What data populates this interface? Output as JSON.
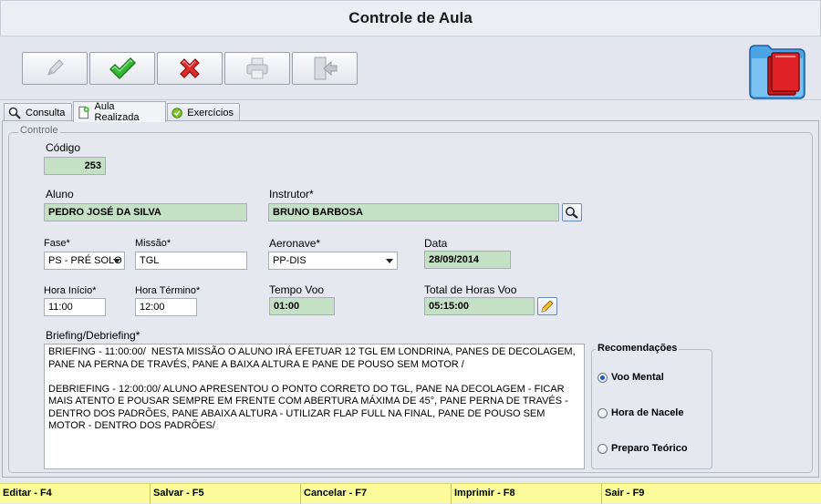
{
  "window": {
    "title": "Controle de Aula"
  },
  "tabs": [
    {
      "label": "Consulta"
    },
    {
      "label": "Aula Realizada"
    },
    {
      "label": "Exercícios"
    }
  ],
  "group": {
    "title": "Controle"
  },
  "form": {
    "codigo": {
      "label": "Código",
      "value": "253"
    },
    "aluno": {
      "label": "Aluno",
      "value": "PEDRO JOSÉ DA SILVA"
    },
    "instrutor": {
      "label": "Instrutor*",
      "value": "BRUNO BARBOSA"
    },
    "fase": {
      "label": "Fase*",
      "value": "PS - PRÉ SOLO"
    },
    "missao": {
      "label": "Missão*",
      "value": "TGL"
    },
    "aeronave": {
      "label": "Aeronave*",
      "value": "PP-DIS"
    },
    "data": {
      "label": "Data",
      "value": "28/09/2014"
    },
    "hora_inicio": {
      "label": "Hora Início*",
      "value": "11:00"
    },
    "hora_termino": {
      "label": "Hora Término*",
      "value": "12:00"
    },
    "tempo_voo": {
      "label": "Tempo Voo",
      "value": "01:00"
    },
    "total_horas": {
      "label": "Total de Horas Voo",
      "value": "05:15:00"
    },
    "briefing": {
      "label": "Briefing/Debriefing*",
      "value": "BRIEFING - 11:00:00/  NESTA MISSÃO O ALUNO IRÁ EFETUAR 12 TGL EM LONDRINA, PANES DE DECOLAGEM, PANE NA PERNA DE TRAVÉS, PANE A BAIXA ALTURA E PANE DE POUSO SEM MOTOR /\n\nDEBRIEFING - 12:00:00/ ALUNO APRESENTOU O PONTO CORRETO DO TGL, PANE NA DECOLAGEM - FICAR MAIS ATENTO E POUSAR SEMPRE EM FRENTE COM ABERTURA MÁXIMA DE 45°, PANE PERNA DE TRAVÉS - DENTRO DOS PADRÕES, PANE ABAIXA ALTURA - UTILIZAR FLAP FULL NA FINAL, PANE DE POUSO SEM MOTOR - DENTRO DOS PADRÕES/"
    }
  },
  "recomendacoes": {
    "title": "Recomendações",
    "options": [
      {
        "label": "Voo Mental",
        "selected": true
      },
      {
        "label": "Hora de Nacele",
        "selected": false
      },
      {
        "label": "Preparo Teórico",
        "selected": false
      }
    ]
  },
  "statusbar": [
    {
      "label": "Editar - F4"
    },
    {
      "label": "Salvar - F5"
    },
    {
      "label": "Cancelar - F7"
    },
    {
      "label": "Imprimir - F8"
    },
    {
      "label": "Sair - F9"
    }
  ],
  "icons": {
    "toolbar": [
      "edit-icon",
      "save-check-icon",
      "cancel-x-icon",
      "print-icon",
      "exit-door-icon"
    ],
    "app": "folder-book-icon"
  },
  "colors": {
    "readonly_field": "#c4e0c5",
    "statusbar": "#fbfb9a",
    "save_green": "#2fa82f",
    "cancel_red": "#d42a2a"
  }
}
